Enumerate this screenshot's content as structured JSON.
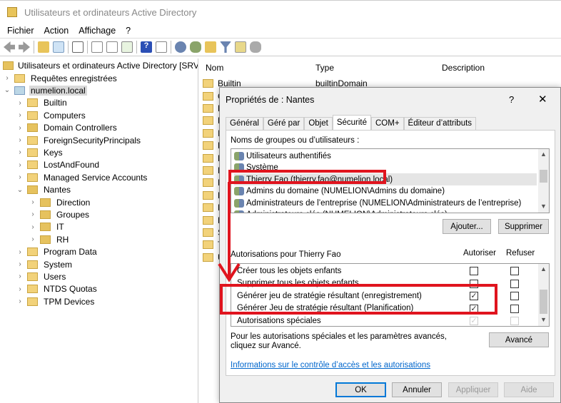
{
  "window": {
    "title": "Utilisateurs et ordinateurs Active Directory"
  },
  "menu": [
    "Fichier",
    "Action",
    "Affichage",
    "?"
  ],
  "tree": {
    "root": "Utilisateurs et ordinateurs Active Directory [SRV-A",
    "items": [
      "Requêtes enregistrées",
      "numelion.local",
      "Builtin",
      "Computers",
      "Domain Controllers",
      "ForeignSecurityPrincipals",
      "Keys",
      "LostAndFound",
      "Managed Service Accounts",
      "Nantes",
      "Direction",
      "Groupes",
      "IT",
      "RH",
      "Program Data",
      "System",
      "Users",
      "NTDS Quotas",
      "TPM Devices"
    ]
  },
  "list": {
    "columns": [
      "Nom",
      "Type",
      "Description"
    ],
    "first_row": {
      "name": "Builtin",
      "type": "builtinDomain"
    },
    "visible_initials": [
      "C",
      "D",
      "F",
      "I",
      "K",
      "L",
      "M",
      "N",
      "N",
      "N",
      "P",
      "S",
      "T",
      "U"
    ]
  },
  "dialog": {
    "title": "Propriétés de : Nantes",
    "help": "?",
    "close": "✕",
    "tabs": [
      "Général",
      "Géré par",
      "Objet",
      "Sécurité",
      "COM+",
      "Éditeur d’attributs"
    ],
    "active_tab": "Sécurité",
    "groups_label": "Noms de groupes ou d’utilisateurs :",
    "groups": [
      "Utilisateurs authentifiés",
      "Système",
      "Thierry Fao (thierry.fao@numelion.local)",
      "Admins du domaine (NUMELION\\Admins du domaine)",
      "Administrateurs de l’entreprise (NUMELION\\Administrateurs de l’entreprise)",
      "Administrateurs clés (NUMELION\\Administrateurs clés)"
    ],
    "selected_group": "Thierry Fao (thierry.fao@numelion.local)",
    "add": "Ajouter...",
    "remove": "Supprimer",
    "perm_label": "Autorisations pour Thierry Fao",
    "allow": "Autoriser",
    "deny": "Refuser",
    "permissions": [
      {
        "name": "Créer tous les objets enfants",
        "allow": false,
        "deny": false
      },
      {
        "name": "Supprimer tous les objets enfants",
        "allow": false,
        "deny": false
      },
      {
        "name": "Générer jeu de stratégie résultant (enregistrement)",
        "allow": true,
        "deny": false
      },
      {
        "name": "Générer Jeu de stratégie résultant (Planification)",
        "allow": true,
        "deny": false
      },
      {
        "name": "Autorisations spéciales",
        "allow": true,
        "deny": false
      }
    ],
    "advanced_text": "Pour les autorisations spéciales et les paramètres avancés, cliquez sur Avancé.",
    "advanced": "Avancé",
    "link": "Informations sur le contrôle d’accès et les autorisations",
    "buttons": {
      "ok": "OK",
      "cancel": "Annuler",
      "apply": "Appliquer",
      "help": "Aide"
    }
  },
  "colors": {
    "annotation": "#e0141e",
    "link": "#0066cc",
    "focus": "#0078d7"
  }
}
